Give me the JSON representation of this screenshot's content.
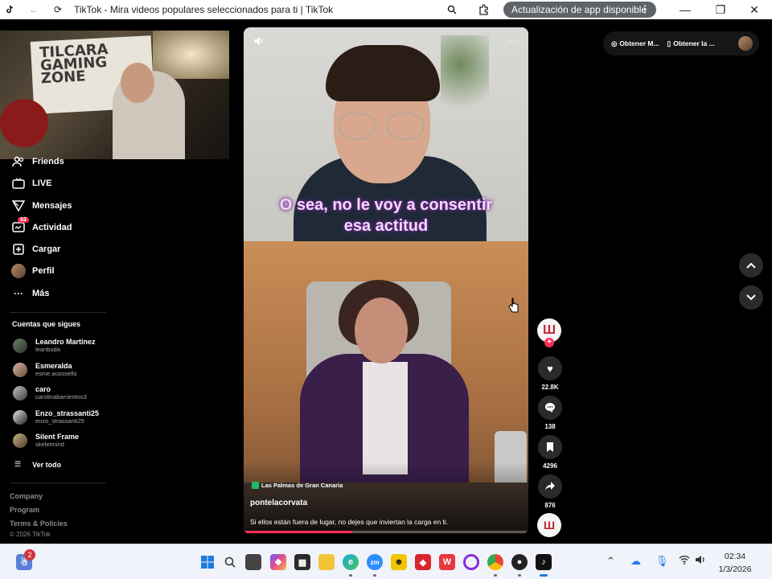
{
  "browser": {
    "title": "TikTok - Mira videos populares seleccionados para ti | TikTok",
    "update_pill": "Actualización de app disponible"
  },
  "webcam": {
    "sign_text": "TILCARA GAMING ZONE"
  },
  "sidebar": {
    "nav": [
      {
        "label": "Friends",
        "icon": "friends-icon"
      },
      {
        "label": "LIVE",
        "icon": "live-icon"
      },
      {
        "label": "Mensajes",
        "icon": "messages-icon"
      },
      {
        "label": "Actividad",
        "icon": "activity-icon",
        "badge": "93"
      },
      {
        "label": "Cargar",
        "icon": "upload-icon"
      },
      {
        "label": "Perfil",
        "icon": "profile-avatar"
      },
      {
        "label": "Más",
        "icon": "more-icon"
      }
    ],
    "following_title": "Cuentas que sigues",
    "following": [
      {
        "name": "Leandro Martinez",
        "handle": "leanbuda"
      },
      {
        "name": "Esmeralda",
        "handle": "esme.ausssello"
      },
      {
        "name": "caro",
        "handle": "carolinabarrientos3"
      },
      {
        "name": "Enzo_strassanti25",
        "handle": "enzo_strassanti25"
      },
      {
        "name": "Silent Frame",
        "handle": "skeletmind"
      }
    ],
    "see_all": "Ver todo",
    "footer": [
      "Company",
      "Program",
      "Terms & Policies"
    ],
    "copyright": "© 2026 TikTok"
  },
  "video": {
    "caption_line1": "O sea, no le voy a consentir",
    "caption_line2": "esa actitud",
    "location": "Las Palmas de Gran Canaria",
    "author": "pontelacorvata",
    "description": "Si ellos están fuera de lugar, no dejes que inviertan la carga en ti.",
    "progress": 0.38
  },
  "actions": {
    "likes": "22.8K",
    "comments": "138",
    "saves": "4296",
    "shares": "876"
  },
  "top_pill": {
    "item1": "Obtener M...",
    "item2": "Obtener la ..."
  },
  "taskbar": {
    "notif_count": "2",
    "time": "02:34",
    "date": "1/3/2026"
  },
  "colors": {
    "accent": "#fe2c55",
    "background": "#000000"
  }
}
